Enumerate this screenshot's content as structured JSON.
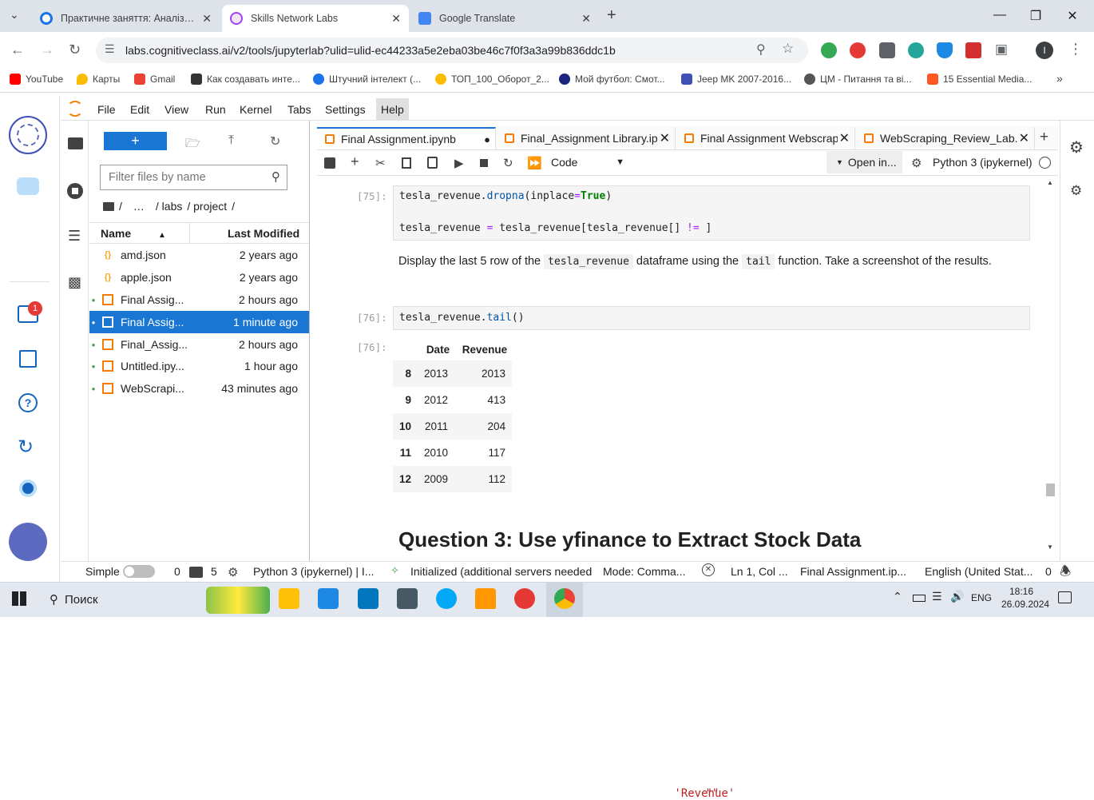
{
  "browser": {
    "tabs": [
      {
        "title": "Практичне заняття: Аналіз істо",
        "icon": "coursera-icon",
        "color": "#1a73e8"
      },
      {
        "title": "Skills Network Labs",
        "icon": "skills-network-icon",
        "color": "#a142f4"
      },
      {
        "title": "Google Translate",
        "icon": "google-translate-icon",
        "color": "#4285f4"
      }
    ],
    "new_tab": "+",
    "url": "labs.cognitiveclass.ai/v2/tools/jupyterlab?ulid=ulid-ec44233a5e2eba03be46c7f0f3a3a99b836ddc1b",
    "profile_initial": "I",
    "bookmarks": [
      {
        "label": "YouTube",
        "color": "#ff0000"
      },
      {
        "label": "Карты",
        "color": "#fbbc04"
      },
      {
        "label": "Gmail",
        "color": "#ea4335"
      },
      {
        "label": "Как создавать инте...",
        "color": "#333333"
      },
      {
        "label": "Штучний інтелект (...",
        "color": "#1a73e8"
      },
      {
        "label": "ТОП_100_Оборот_2...",
        "color": "#fbbc04"
      },
      {
        "label": "Мой футбол: Смот...",
        "color": "#1a237e"
      },
      {
        "label": "Jeep MK 2007-2016...",
        "color": "#3f51b5"
      },
      {
        "label": "ЦМ - Питання та ві...",
        "color": "#555555"
      },
      {
        "label": "15 Essential Media...",
        "color": "#ff5722"
      }
    ]
  },
  "skills_sidebar": {
    "notification_count": "1"
  },
  "jupyter": {
    "menu": [
      "File",
      "Edit",
      "View",
      "Run",
      "Kernel",
      "Tabs",
      "Settings",
      "Help"
    ],
    "filebrowser": {
      "filter_placeholder": "Filter files by name",
      "breadcrumb": [
        "/",
        "…",
        "/ labs",
        "/ project",
        "/"
      ],
      "col_name": "Name",
      "col_modified": "Last Modified",
      "files": [
        {
          "name": "amd.json",
          "modified": "2 years ago",
          "type": "json",
          "running": false,
          "selected": false
        },
        {
          "name": "apple.json",
          "modified": "2 years ago",
          "type": "json",
          "running": false,
          "selected": false
        },
        {
          "name": "Final Assig...",
          "modified": "2 hours ago",
          "type": "notebook",
          "running": true,
          "selected": false
        },
        {
          "name": "Final Assig...",
          "modified": "1 minute ago",
          "type": "notebook",
          "running": true,
          "selected": true
        },
        {
          "name": "Final_Assig...",
          "modified": "2 hours ago",
          "type": "notebook",
          "running": true,
          "selected": false
        },
        {
          "name": "Untitled.ipy...",
          "modified": "1 hour ago",
          "type": "notebook",
          "running": true,
          "selected": false
        },
        {
          "name": "WebScrapi...",
          "modified": "43 minutes ago",
          "type": "notebook",
          "running": true,
          "selected": false
        }
      ]
    },
    "notebook_tabs": [
      {
        "title": "Final Assignment.ipynb",
        "active": true,
        "modified": true
      },
      {
        "title": "Final_Assignment Library.ip",
        "active": false
      },
      {
        "title": "Final Assignment Webscrap",
        "active": false
      },
      {
        "title": "WebScraping_Review_Lab.i",
        "active": false
      }
    ],
    "toolbar": {
      "cell_type": "Code",
      "open_in": "Open in...",
      "kernel": "Python 3 (ipykernel)"
    },
    "cells": {
      "cell75_prompt": "[75]:",
      "cell75_line1_a": "tesla_revenue.",
      "cell75_line1_fn": "dropna",
      "cell75_line1_b": "(inplace",
      "cell75_line1_op": "=",
      "cell75_line1_kw": "True",
      "cell75_line1_c": ")",
      "cell75_line2_a": "tesla_revenue ",
      "cell75_line2_op1": "=",
      "cell75_line2_b": " tesla_revenue[tesla_revenue[",
      "cell75_line2_st": "'Revenue'",
      "cell75_line2_c": "] ",
      "cell75_line2_op2": "!=",
      "cell75_line2_st2": "\"\"",
      "cell75_line2_d": "]",
      "md_text_1": "Display the last 5 row of the ",
      "md_code_1": "tesla_revenue",
      "md_text_2": " dataframe using the ",
      "md_code_2": "tail",
      "md_text_3": " function. Take a screenshot of the results.",
      "cell76_prompt": "[76]:",
      "cell76_code_a": "tesla_revenue.",
      "cell76_code_fn": "tail",
      "cell76_code_b": "()",
      "out76_prompt": "[76]:",
      "table_headers": [
        "",
        "Date",
        "Revenue"
      ],
      "table_rows": [
        [
          "8",
          "2013",
          "2013"
        ],
        [
          "9",
          "2012",
          "413"
        ],
        [
          "10",
          "2011",
          "204"
        ],
        [
          "11",
          "2010",
          "117"
        ],
        [
          "12",
          "2009",
          "112"
        ]
      ],
      "heading": "Question 3: Use yfinance to Extract Stock Data"
    },
    "status": {
      "mode_label": "Simple",
      "terminals": "0",
      "kernels": "5",
      "kernel": "Python 3 (ipykernel) | I...",
      "lsp": "Initialized (additional servers needed",
      "mode": "Mode: Comma...",
      "cursor": "Ln 1, Col ...",
      "file": "Final Assignment.ip...",
      "language": "English (United Stat...",
      "notifications": "0"
    }
  },
  "taskbar": {
    "search": "Поиск",
    "language": "ENG",
    "time": "18:16",
    "date": "26.09.2024"
  }
}
